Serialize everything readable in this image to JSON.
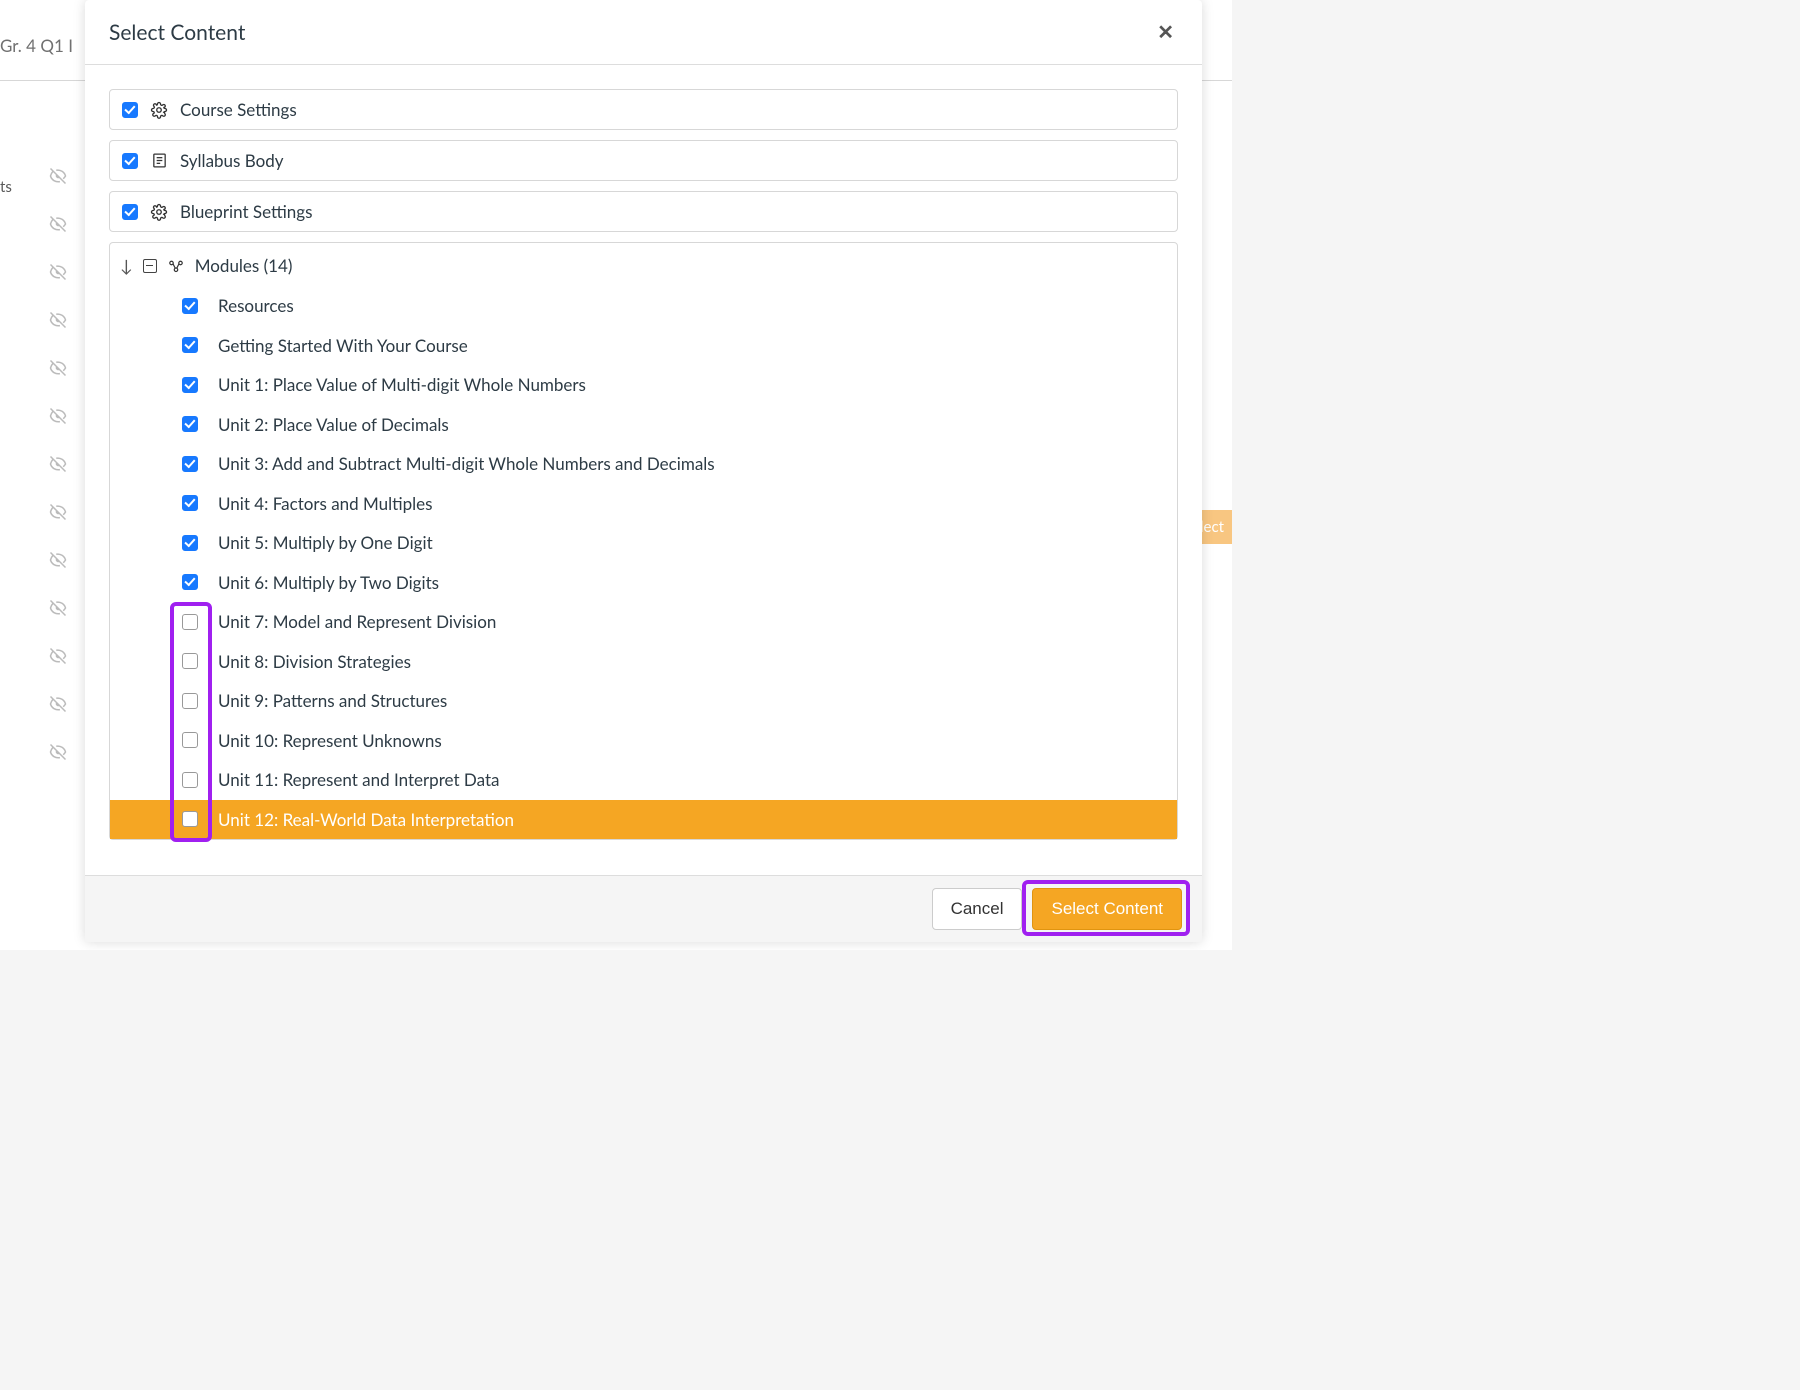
{
  "background": {
    "title_fragment": "Gr. 4 Q1 I",
    "ts_fragment": "ts",
    "select_fragment": "elect"
  },
  "modal": {
    "title": "Select Content",
    "cards": {
      "course_settings": {
        "label": "Course Settings",
        "checked": true
      },
      "syllabus_body": {
        "label": "Syllabus Body",
        "checked": true
      },
      "blueprint_settings": {
        "label": "Blueprint Settings",
        "checked": true
      }
    },
    "modules_header": "Modules (14)",
    "modules": [
      {
        "label": "Resources",
        "checked": true
      },
      {
        "label": "Getting Started With Your Course",
        "checked": true
      },
      {
        "label": "Unit 1: Place Value of Multi-digit Whole Numbers",
        "checked": true
      },
      {
        "label": "Unit 2: Place Value of Decimals",
        "checked": true
      },
      {
        "label": "Unit 3: Add and Subtract Multi-digit Whole Numbers and Decimals",
        "checked": true
      },
      {
        "label": "Unit 4: Factors and Multiples",
        "checked": true
      },
      {
        "label": "Unit 5: Multiply by One Digit",
        "checked": true
      },
      {
        "label": "Unit 6: Multiply by Two Digits",
        "checked": true
      },
      {
        "label": "Unit 7: Model and Represent Division",
        "checked": false
      },
      {
        "label": "Unit 8: Division Strategies",
        "checked": false
      },
      {
        "label": "Unit 9: Patterns and Structures",
        "checked": false
      },
      {
        "label": "Unit 10: Represent Unknowns",
        "checked": false
      },
      {
        "label": "Unit 11: Represent and Interpret Data",
        "checked": false
      },
      {
        "label": "Unit 12: Real-World Data Interpretation",
        "checked": false,
        "highlighted": true
      }
    ],
    "footer": {
      "cancel": "Cancel",
      "select": "Select Content"
    }
  }
}
